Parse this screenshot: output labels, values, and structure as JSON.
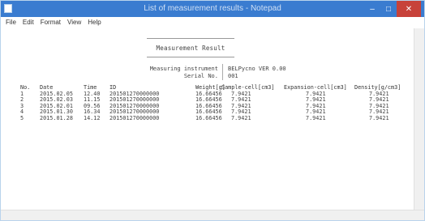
{
  "window": {
    "title": "List of measurement results - Notepad",
    "controls": [
      "–",
      "□",
      "✕"
    ]
  },
  "menu": [
    "File",
    "Edit",
    "Format",
    "View",
    "Help"
  ],
  "document": {
    "title": "Measurement Result",
    "instrument_label": "Measuring instrument",
    "instrument_value": "BELPycno VER 0.00",
    "serial_label": "Serial No.",
    "serial_value": "001",
    "table": {
      "headers": [
        "No.",
        "Date",
        "Time",
        "ID",
        "Weight[g]",
        "Sample-cell[cm3]",
        "Expansion-cell[cm3]",
        "Density[g/cm3]"
      ],
      "rows": [
        [
          "1",
          "2015.02.05",
          "12.40",
          "201501270000000",
          "16.66456",
          "7.9421",
          "7.9421",
          "7.9421"
        ],
        [
          "2",
          "2015.02.03",
          "11.15",
          "201501270000000",
          "16.66456",
          "7.9421",
          "7.9421",
          "7.9421"
        ],
        [
          "3",
          "2015.02.01",
          "09.56",
          "201501270000000",
          "16.66456",
          "7.9421",
          "7.9421",
          "7.9421"
        ],
        [
          "4",
          "2015.01.30",
          "16.34",
          "201501270000000",
          "16.66456",
          "7.9421",
          "7.9421",
          "7.9421"
        ],
        [
          "5",
          "2015.01.28",
          "14.12",
          "201501270000000",
          "16.66456",
          "7.9421",
          "7.9421",
          "7.9421"
        ]
      ]
    }
  }
}
